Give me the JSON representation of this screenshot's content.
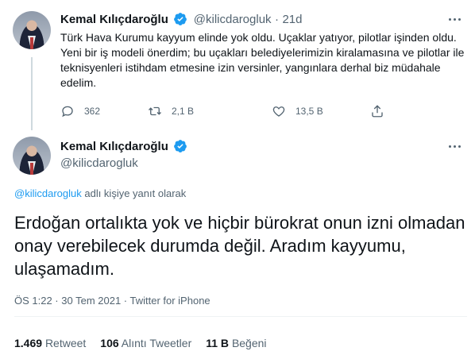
{
  "parent_tweet": {
    "author_name": "Kemal Kılıçdaroğlu",
    "handle": "@kilicdarogluk",
    "separator": "·",
    "time": "21d",
    "text": "Türk Hava Kurumu kayyum elinde yok oldu. Uçaklar yatıyor, pilotlar işinden oldu. Yeni bir iş modeli önerdim; bu uçakları belediyelerimizin kiralamasına ve pilotlar ile teknisyenleri istihdam etmesine izin versinler, yangınlara derhal biz müdahale edelim.",
    "replies": "362",
    "retweets": "2,1 B",
    "likes": "13,5 B"
  },
  "main_tweet": {
    "author_name": "Kemal Kılıçdaroğlu",
    "handle": "@kilicdarogluk",
    "reply_to_handle": "@kilicdarogluk",
    "reply_to_suffix": "adlı kişiye yanıt olarak",
    "text": "Erdoğan ortalıkta yok ve hiçbir bürokrat onun izni olmadan onay verebilecek durumda değil. Aradım kayyumu, ulaşamadım.",
    "timestamp": "ÖS 1:22 · 30 Tem 2021 · Twitter for iPhone",
    "retweet_count": "1.469",
    "retweet_label": "Retweet",
    "quote_count": "106",
    "quote_label": "Alıntı Tweetler",
    "like_count": "11 B",
    "like_label": "Beğeni"
  },
  "icons": {
    "verified": "verified-badge-icon",
    "more": "more-options-icon",
    "reply": "reply-icon",
    "retweet": "retweet-icon",
    "like": "heart-icon",
    "share": "share-icon"
  },
  "colors": {
    "accent": "#1d9bf0",
    "text": "#0f1419",
    "muted": "#536471",
    "divider": "#eff3f4"
  }
}
